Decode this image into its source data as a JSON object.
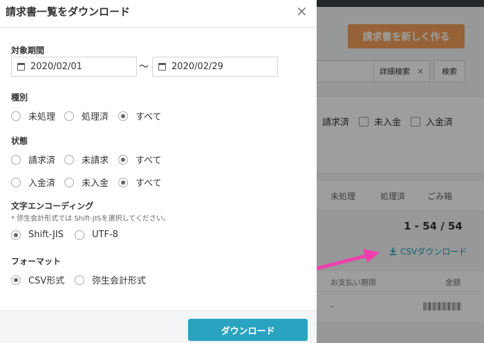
{
  "modal": {
    "title": "請求書一覧をダウンロード",
    "close_icon": "×",
    "period": {
      "label": "対象期間",
      "start": "2020/02/01",
      "separator": "〜",
      "end": "2020/02/29"
    },
    "type": {
      "label": "種別",
      "options": [
        "未処理",
        "処理済",
        "すべて"
      ],
      "selected": "すべて"
    },
    "status": {
      "label": "状態",
      "row1": [
        "請求済",
        "未請求",
        "すべて"
      ],
      "row1_selected": "すべて",
      "row2": [
        "入金済",
        "未入金",
        "すべて"
      ],
      "row2_selected": "すべて"
    },
    "encoding": {
      "label": "文字エンコーディング",
      "note": "* 弥生会計形式では Shift-JISを選択してください。",
      "options": [
        "Shift-JIS",
        "UTF-8"
      ],
      "selected": "Shift-JIS"
    },
    "format": {
      "label": "フォーマット",
      "options": [
        "CSV形式",
        "弥生会計形式"
      ],
      "selected": "CSV形式"
    },
    "download_label": "ダウンロード"
  },
  "background": {
    "new_invoice_button": "請求書を新しく作る",
    "detail_search": "詳細検索",
    "detail_search_clear": "×",
    "search_button": "検索",
    "filters": [
      "請求済",
      "未入金",
      "入金済"
    ],
    "tabs": [
      "未処理",
      "処理済",
      "ごみ箱"
    ],
    "count": "1 - 54 / 54",
    "csv_download": "CSVダウンロード",
    "table_headers": [
      "お支払い期限",
      "金額"
    ],
    "row_due": "-"
  },
  "colors": {
    "accent": "#2aa3c0",
    "new_button": "#f0a05a",
    "arrow": "#ef3fae",
    "link": "#1a9fb5"
  }
}
